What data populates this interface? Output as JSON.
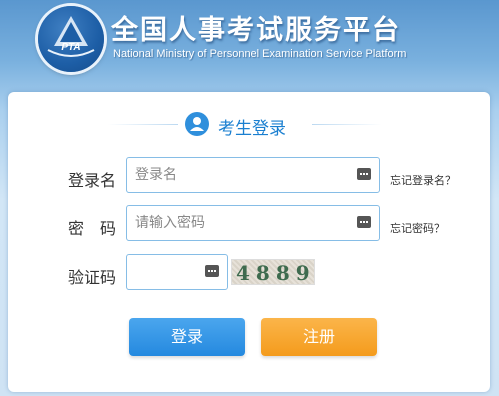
{
  "header": {
    "logo_text": "PTA",
    "title": "全国人事考试服务平台",
    "subtitle": "National Ministry of Personnel Examination Service Platform"
  },
  "login": {
    "title": "考生登录",
    "username": {
      "label": "登录名",
      "placeholder": "登录名",
      "value": "",
      "forgot": "忘记登录名？"
    },
    "password": {
      "label": "密　码",
      "placeholder": "请输入密码",
      "value": "",
      "forgot": "忘记密码？"
    },
    "captcha": {
      "label": "验证码",
      "value": "",
      "image_text": "4889"
    },
    "login_button": "登录",
    "register_button": "注册"
  },
  "colors": {
    "accent_blue": "#2489df",
    "accent_orange": "#f49b1c",
    "title_blue": "#1a7fd0"
  }
}
